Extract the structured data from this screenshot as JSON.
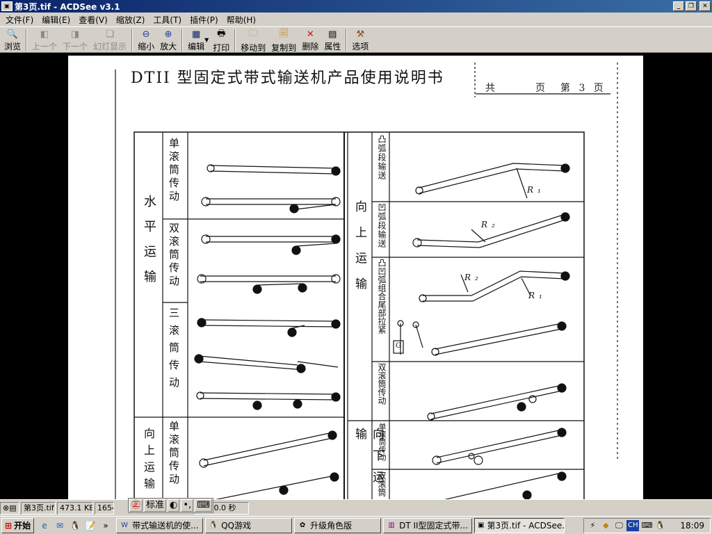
{
  "window": {
    "title": "第3页.tif - ACDSee v3.1"
  },
  "menu": [
    "文件(F)",
    "编辑(E)",
    "查看(V)",
    "缩放(Z)",
    "工具(T)",
    "插件(P)",
    "帮助(H)"
  ],
  "toolbar": {
    "browse": "浏览",
    "prev": "上一个",
    "next": "下一个",
    "slideshow": "幻灯显示",
    "zoom_out": "缩小",
    "zoom_in": "放大",
    "edit": "编辑",
    "print": "打印",
    "move_to": "移动到",
    "copy_to": "复制到",
    "delete": "删除",
    "properties": "属性",
    "options": "选项"
  },
  "document": {
    "title": "DTII 型固定式带式输送机产品使用说明书",
    "page_label": "共　　　页　第 3 页",
    "left_col": {
      "horizontal": "水平运输",
      "single_drum": "单滚筒传动",
      "double_drum": "双滚筒传动",
      "triple_drum": "三滚筒传动",
      "upward": "向上运输",
      "upward_single": "单滚筒传动"
    },
    "right_col": {
      "upward": "向上运输",
      "convex": "凸弧段输送",
      "concave": "凹弧段输送",
      "combined": "凸凹弧组合尾部拉紧",
      "double_drum": "双滚筒传动",
      "downward": "向下运输",
      "down_single": "单滚筒传动",
      "down_double": "双滚筒"
    },
    "annotations": {
      "r1": "R₁",
      "r2": "R₂",
      "g": "G"
    }
  },
  "statusbar": {
    "filename": "第3页.tif",
    "size": "473.1 KB",
    "dims": "1654",
    "loadtime": "用时 0.0 秒"
  },
  "ime": {
    "mode": "标准"
  },
  "taskbar": {
    "start": "开始",
    "tasks": [
      "带式输送机的使...",
      "QQ游戏",
      "升级角色版",
      "DT II型固定式带...",
      "第3页.tif - ACDSee..."
    ],
    "ime_lang": "CH",
    "clock": "18:09"
  }
}
